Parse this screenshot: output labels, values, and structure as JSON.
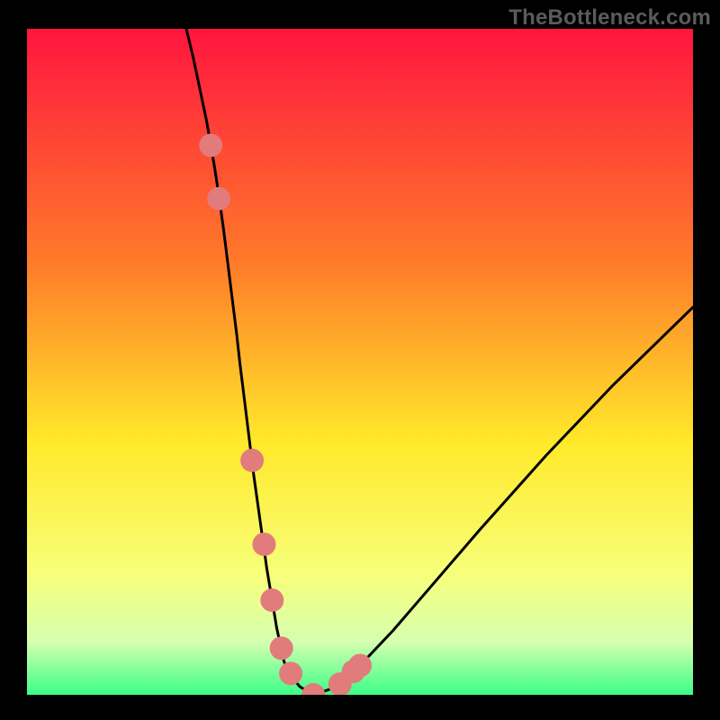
{
  "watermark": "TheBottleneck.com",
  "colors": {
    "bg_black": "#000000",
    "gradient_top": "#ff153f",
    "gradient_mid1": "#ff7a2a",
    "gradient_mid2": "#ffe92a",
    "gradient_bottom1": "#f7ff7a",
    "gradient_bottom2": "#d6ffb0",
    "gradient_bottom3": "#3bff87",
    "curve": "#000000",
    "marker_fill": "#e27b7b",
    "marker_stroke": "#e27b7b"
  },
  "chart_data": {
    "type": "line",
    "x": [
      0,
      5,
      10,
      13.8,
      14.5,
      15,
      18,
      20,
      20.5,
      22,
      25,
      27,
      27.6,
      28.2,
      28.8,
      29.5,
      30,
      30.5,
      31,
      31.5,
      32,
      32.5,
      34,
      36,
      37.5,
      38.6,
      39.4,
      41,
      43,
      46,
      50,
      55,
      60,
      68,
      78,
      88,
      100
    ],
    "y": [
      170,
      160.5,
      148,
      137,
      135,
      133,
      123.5,
      116,
      114.2,
      108,
      95.5,
      86,
      82.5,
      79,
      75,
      70,
      66,
      62,
      58,
      54,
      49.5,
      45.5,
      33.3,
      19,
      10,
      5,
      3,
      1.2,
      0,
      1,
      4.4,
      9.7,
      15.5,
      24.8,
      36,
      46.5,
      58.2
    ],
    "markers_x": [
      27.6,
      28.8,
      33.8,
      35.6,
      36.8,
      38.2,
      39.6,
      43,
      47,
      49,
      50
    ],
    "markers_y": [
      82.5,
      74.5,
      35.2,
      22.6,
      14.2,
      7,
      3.2,
      0,
      1.6,
      3.5,
      4.4
    ],
    "ylim": [
      0,
      100
    ],
    "xlim": [
      0,
      100
    ],
    "title": "",
    "xlabel": "",
    "ylabel": ""
  }
}
